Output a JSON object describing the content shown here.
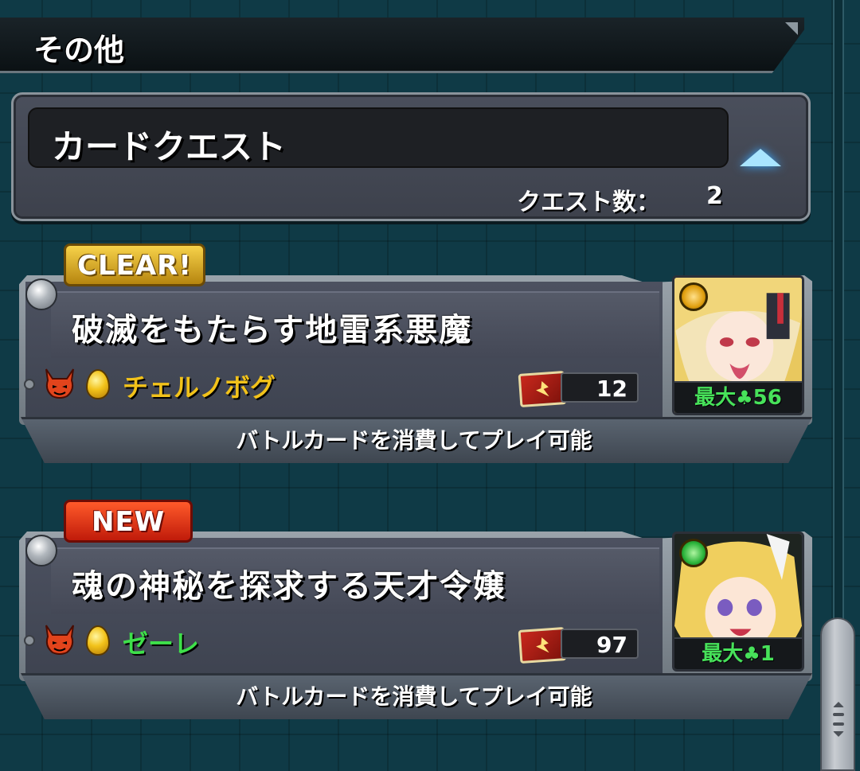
{
  "section": {
    "title": "その他"
  },
  "card_quest": {
    "title": "カードクエスト",
    "count_label": "クエスト数：",
    "count_value": "2"
  },
  "quests": [
    {
      "badge": "CLEAR!",
      "name": "破滅をもたらす地雷系悪魔",
      "boss": "チェルノボグ",
      "boss_color": "#f2c21a",
      "card_count": "12",
      "max_label": "最大",
      "max_value": "56",
      "footer": "バトルカードを消費してプレイ可能",
      "attr_color": "#e0a010"
    },
    {
      "badge": "NEW",
      "name": "魂の神秘を探求する天才令嬢",
      "boss": "ゼーレ",
      "boss_color": "#3ee04a",
      "card_count": "97",
      "max_label": "最大",
      "max_value": "1",
      "footer": "バトルカードを消費してプレイ可能",
      "attr_color": "#2bb33a"
    }
  ],
  "icons": {
    "clover": "♣"
  }
}
